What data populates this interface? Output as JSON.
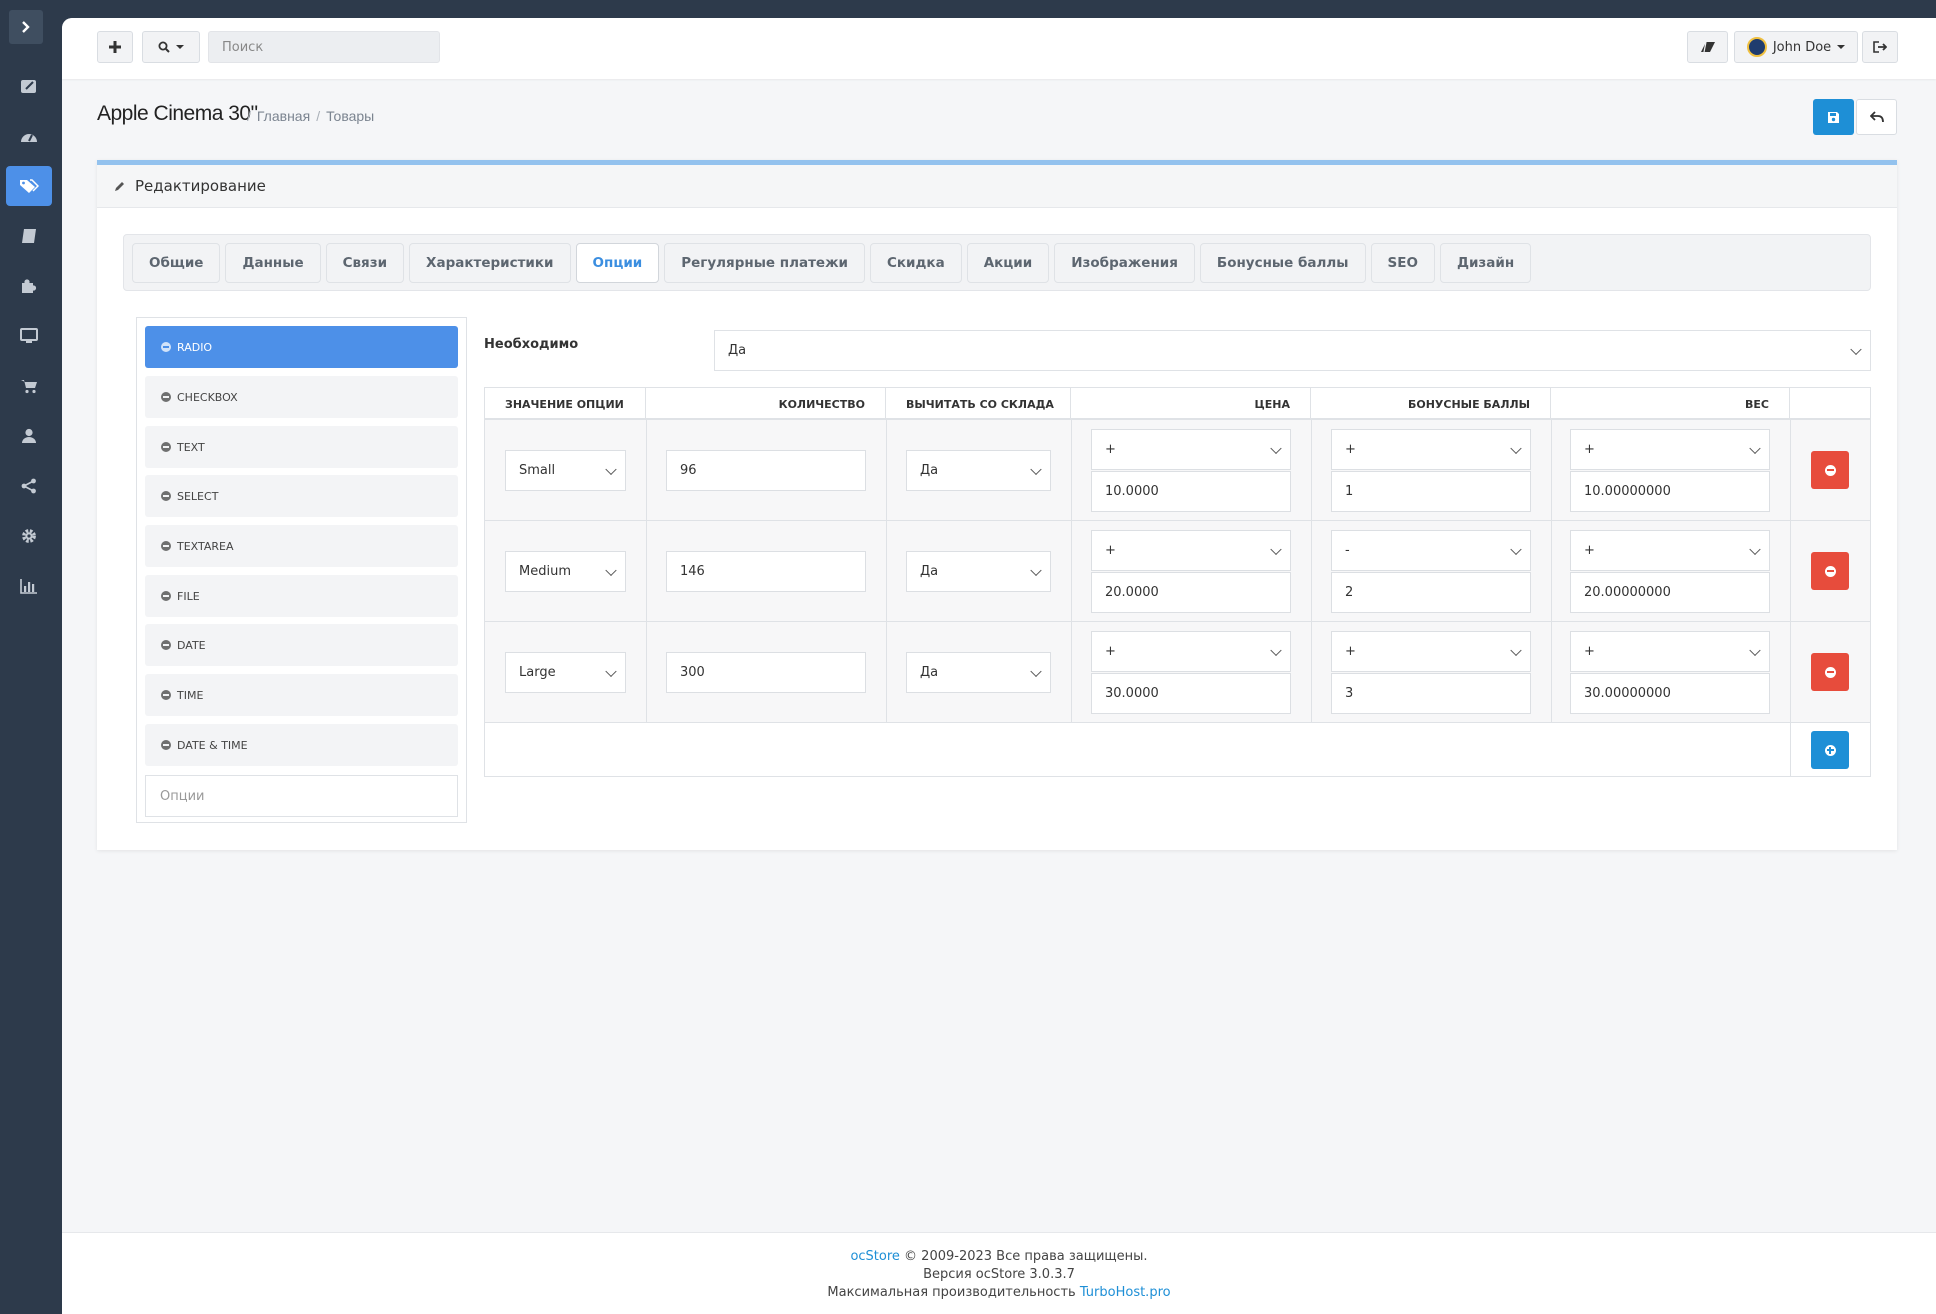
{
  "header": {
    "search_placeholder": "Поиск",
    "user_name": "John Doe"
  },
  "page": {
    "title": "Apple Cinema 30\"",
    "breadcrumb": [
      "Главная",
      "Товары"
    ]
  },
  "panel": {
    "title": "Редактирование"
  },
  "tabs": [
    {
      "label": "Общие"
    },
    {
      "label": "Данные"
    },
    {
      "label": "Связи"
    },
    {
      "label": "Характеристики"
    },
    {
      "label": "Опции",
      "active": true
    },
    {
      "label": "Регулярные платежи"
    },
    {
      "label": "Скидка"
    },
    {
      "label": "Акции"
    },
    {
      "label": "Изображения"
    },
    {
      "label": "Бонусные баллы"
    },
    {
      "label": "SEO"
    },
    {
      "label": "Дизайн"
    }
  ],
  "options": {
    "items": [
      "RADIO",
      "CHECKBOX",
      "TEXT",
      "SELECT",
      "TEXTAREA",
      "FILE",
      "DATE",
      "TIME",
      "DATE & TIME"
    ],
    "active": "RADIO",
    "input_placeholder": "Опции"
  },
  "required": {
    "label": "Необходимо",
    "value": "Да"
  },
  "table": {
    "headers": [
      "ЗНАЧЕНИЕ ОПЦИИ",
      "КОЛИЧЕСТВО",
      "ВЫЧИТАТЬ СО СКЛАДА",
      "ЦЕНА",
      "БОНУСНЫЕ БАЛЛЫ",
      "ВЕС"
    ],
    "rows": [
      {
        "option": "Small",
        "quantity": "96",
        "subtract": "Да",
        "price_prefix": "+",
        "price": "10.0000",
        "points_prefix": "+",
        "points": "1",
        "weight_prefix": "+",
        "weight": "10.00000000"
      },
      {
        "option": "Medium",
        "quantity": "146",
        "subtract": "Да",
        "price_prefix": "+",
        "price": "20.0000",
        "points_prefix": "-",
        "points": "2",
        "weight_prefix": "+",
        "weight": "20.00000000"
      },
      {
        "option": "Large",
        "quantity": "300",
        "subtract": "Да",
        "price_prefix": "+",
        "price": "30.0000",
        "points_prefix": "+",
        "points": "3",
        "weight_prefix": "+",
        "weight": "30.00000000"
      }
    ]
  },
  "footer": {
    "brand": "ocStore",
    "copyright": "© 2009-2023 Все права защищены.",
    "version": "Версия ocStore 3.0.3.7",
    "perf_text": "Максимальная производительность",
    "perf_link": "TurboHost.pro"
  },
  "colors": {
    "sidebar": "#2d3a4b",
    "accent": "#4d90e8",
    "primary_button": "#1e8fd6",
    "danger_button": "#e74c3c"
  }
}
